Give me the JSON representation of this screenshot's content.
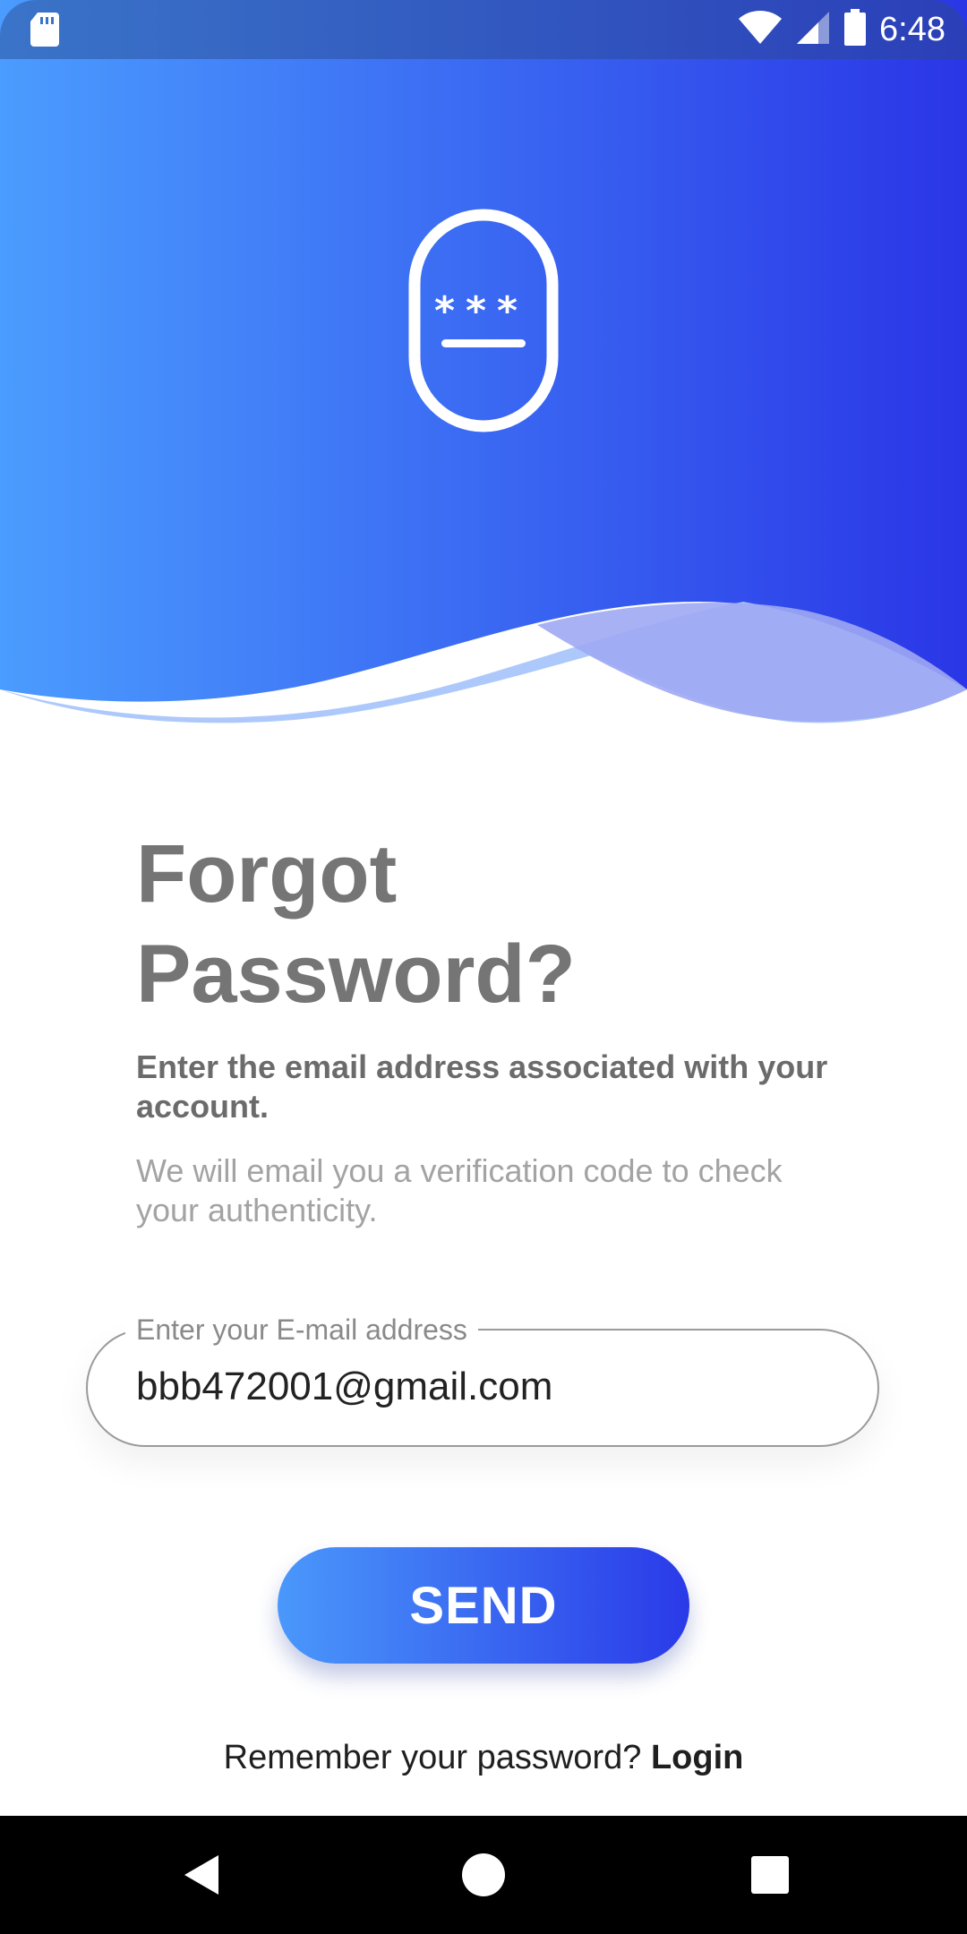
{
  "status_bar": {
    "time": "6:48",
    "icons": [
      "sd-card-icon",
      "wifi-icon",
      "signal-icon",
      "battery-icon"
    ]
  },
  "header": {
    "icon": "password-lock-icon",
    "gradient_colors": [
      "#4b9cff",
      "#2a36e6"
    ]
  },
  "content": {
    "title_line1": "Forgot",
    "title_line2": "Password?",
    "subtitle_bold": "Enter the email address associated with your account.",
    "subtitle_light": "We will email you a verification code to check your authenticity."
  },
  "email_field": {
    "label": "Enter your E-mail address",
    "value": "bbb472001@gmail.com"
  },
  "send_button": {
    "label": "SEND"
  },
  "footer": {
    "prompt": "Remember your password?",
    "link": "Login"
  },
  "nav_bar": {
    "icons": [
      "back-icon",
      "home-icon",
      "recents-icon"
    ]
  }
}
